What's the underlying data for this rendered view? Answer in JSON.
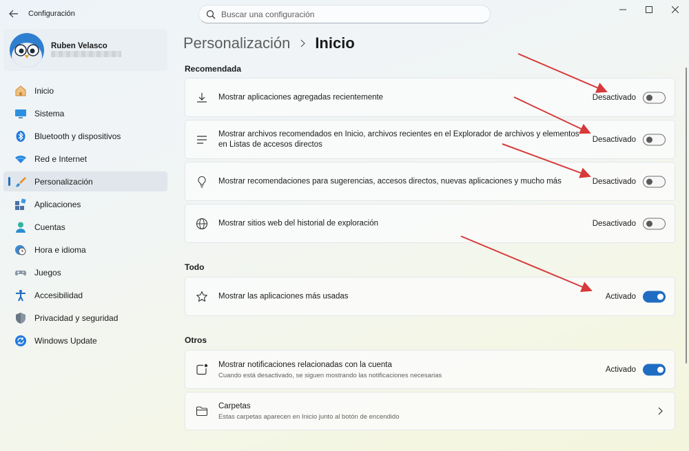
{
  "window": {
    "title": "Configuración",
    "search_placeholder": "Buscar una configuración"
  },
  "profile": {
    "name": "Ruben Velasco"
  },
  "sidebar": {
    "items": [
      {
        "label": "Inicio",
        "icon": "home-icon"
      },
      {
        "label": "Sistema",
        "icon": "monitor-icon"
      },
      {
        "label": "Bluetooth y dispositivos",
        "icon": "bluetooth-icon"
      },
      {
        "label": "Red e Internet",
        "icon": "wifi-icon"
      },
      {
        "label": "Personalización",
        "icon": "brush-icon",
        "active": true
      },
      {
        "label": "Aplicaciones",
        "icon": "apps-icon"
      },
      {
        "label": "Cuentas",
        "icon": "person-icon"
      },
      {
        "label": "Hora e idioma",
        "icon": "clock-globe-icon"
      },
      {
        "label": "Juegos",
        "icon": "gamepad-icon"
      },
      {
        "label": "Accesibilidad",
        "icon": "accessibility-icon"
      },
      {
        "label": "Privacidad y seguridad",
        "icon": "shield-icon"
      },
      {
        "label": "Windows Update",
        "icon": "update-icon"
      }
    ]
  },
  "breadcrumb": {
    "parent": "Personalización",
    "current": "Inicio"
  },
  "sections": {
    "recomendada": {
      "title": "Recomendada",
      "items": [
        {
          "label": "Mostrar aplicaciones agregadas recientemente",
          "state": "Desactivado",
          "on": false,
          "icon": "download-icon"
        },
        {
          "label": "Mostrar archivos recomendados en Inicio, archivos recientes en el Explorador de archivos y elementos en Listas de accesos directos",
          "state": "Desactivado",
          "on": false,
          "icon": "list-lines-icon"
        },
        {
          "label": "Mostrar recomendaciones para sugerencias, accesos directos, nuevas aplicaciones y mucho más",
          "state": "Desactivado",
          "on": false,
          "icon": "lightbulb-icon"
        },
        {
          "label": "Mostrar sitios web del historial de exploración",
          "state": "Desactivado",
          "on": false,
          "icon": "globe-icon"
        }
      ]
    },
    "todo": {
      "title": "Todo",
      "items": [
        {
          "label": "Mostrar las aplicaciones más usadas",
          "state": "Activado",
          "on": true,
          "icon": "star-icon"
        }
      ]
    },
    "otros": {
      "title": "Otros",
      "items": [
        {
          "label": "Mostrar notificaciones relacionadas con la cuenta",
          "sublabel": "Cuando está desactivado, se siguen mostrando las notificaciones necesarias",
          "state": "Activado",
          "on": true,
          "icon": "notification-square-icon"
        },
        {
          "label": "Carpetas",
          "sublabel": "Estas carpetas aparecen en Inicio junto al botón de encendido",
          "icon": "folder-icon"
        }
      ]
    }
  },
  "colors": {
    "accent": "#1f6dc2",
    "annotation_arrow": "#d63a3a"
  }
}
